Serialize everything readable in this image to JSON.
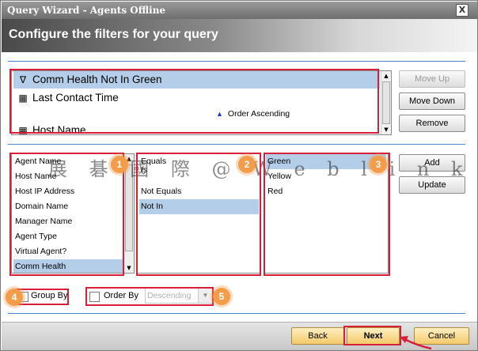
{
  "window": {
    "title": "Query Wizard - Agents Offline",
    "close_glyph": "X"
  },
  "banner": {
    "heading": "Configure the filters for your query"
  },
  "filters": {
    "rows": [
      {
        "icon": "funnel-icon",
        "glyph": "∇",
        "label": "Comm Health Not In Green",
        "selected": true
      },
      {
        "icon": "calendar-icon",
        "glyph": "▦",
        "label": "Last Contact Time",
        "selected": false
      },
      {
        "icon": "calendar-icon",
        "glyph": "▦",
        "label": "Host Name",
        "selected": false
      }
    ],
    "order_label": "Order Ascending"
  },
  "side_buttons": {
    "move_up": "Move Up",
    "move_down": "Move Down",
    "remove": "Remove",
    "add": "Add",
    "update": "Update"
  },
  "fields": {
    "items": [
      "Agent Name",
      "Host Name",
      "Host IP Address",
      "Domain Name",
      "Manager Name",
      "Agent Type",
      "Virtual Agent?",
      "Comm Health"
    ],
    "selected_index": 7
  },
  "operators": {
    "items": [
      "Equals",
      "Is",
      "Not Equals",
      "Not In"
    ],
    "selected_index": 3
  },
  "values": {
    "items": [
      "Green",
      "Yellow",
      "Red"
    ],
    "selected_index": 0
  },
  "options": {
    "group_by_label": "Group By",
    "order_by_label": "Order By",
    "order_direction": "Descending"
  },
  "footer": {
    "back": "Back",
    "next": "Next",
    "cancel": "Cancel"
  },
  "annotations": {
    "badges": [
      "1",
      "2",
      "3",
      "4",
      "5"
    ],
    "watermark": "展 碁 國 際 @ W e b l i n k"
  },
  "colors": {
    "highlight": "#b4cde9",
    "annotation_red": "#d6203a",
    "badge_orange": "#f39c4a",
    "rule_blue": "#4a86c8"
  }
}
